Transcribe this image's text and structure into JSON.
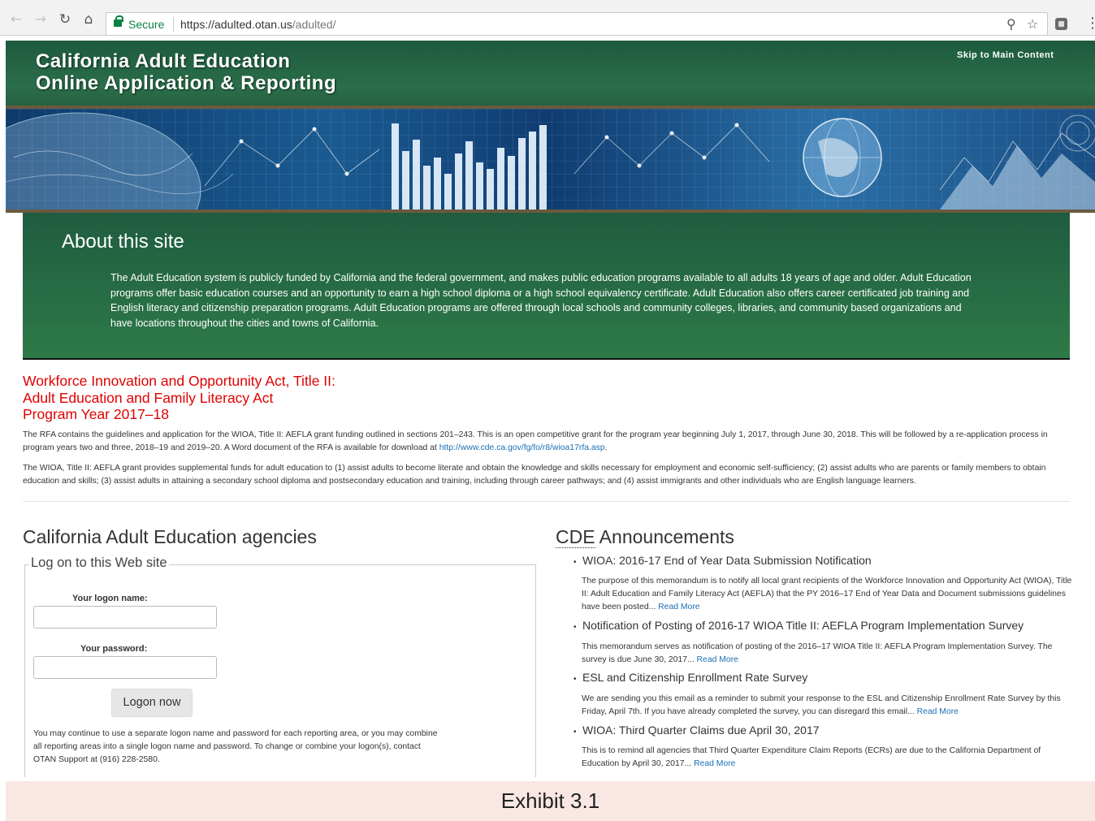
{
  "browser": {
    "secure_label": "Secure",
    "url_host": "https://adulted.otan.us",
    "url_path": "/adulted/",
    "icons": [
      "back-arrow-icon",
      "forward-arrow-icon",
      "reload-icon",
      "home-icon",
      "lock-icon",
      "zoom-icon",
      "star-icon",
      "extension-icon",
      "menu-icon"
    ]
  },
  "header": {
    "title_line1": "California Adult Education",
    "title_line2": "Online Application & Reporting",
    "skip_link": "Skip to Main Content"
  },
  "about": {
    "title": "About this site",
    "text": "The Adult Education system is publicly funded by California and the federal government, and makes public education programs available to all adults 18 years of age and older. Adult Education programs offer basic education courses and an opportunity to earn a high school diploma or a high school equivalency certificate. Adult Education also offers career certificated job training and English literacy and citizenship preparation programs. Adult Education programs are offered through local schools and community colleges, libraries, and community based organizations and have locations throughout the cities and towns of California."
  },
  "wioa": {
    "title_line1": "Workforce Innovation and Opportunity Act, Title II:",
    "title_line2": "Adult Education and Family Literacy Act",
    "title_line3": "Program Year 2017–18",
    "para1": "The RFA contains the guidelines and application for the WIOA, Title II: AEFLA grant funding outlined in sections 201–243. This is an open competitive grant for the program year beginning July 1, 2017, through June 30, 2018. This will be followed by a re-application process in program years two and three, 2018–19 and 2019–20. A Word document of the RFA is available for download at",
    "para1_link": "http://www.cde.ca.gov/fg/fo/r8/wioa17rfa.asp",
    "para1_end": ".",
    "para2": "The WIOA, Title II: AEFLA grant provides supplemental funds for adult education to (1) assist adults to become literate and obtain the knowledge and skills necessary for employment and economic self-sufficiency; (2) assist adults who are parents or family members to obtain education and skills; (3) assist adults in attaining a secondary school diploma and postsecondary education and training, including through career pathways; and (4) assist immigrants and other individuals who are English language learners."
  },
  "agencies": {
    "title": "California Adult Education agencies",
    "legend": "Log on to this Web site",
    "logon_label": "Your logon name:",
    "logon_value": "",
    "password_label": "Your password:",
    "password_value": "",
    "button": "Logon now",
    "note": "You may continue to use a separate logon name and password for each reporting area, or you may combine all reporting areas into a single logon name and password. To change or combine your logon(s), contact OTAN Support at (916) 228-2580."
  },
  "announcements": {
    "title_abbr": "CDE",
    "title_rest": " Announcements",
    "read_more": "Read More",
    "items": [
      {
        "title": "WIOA: 2016-17 End of Year Data Submission Notification",
        "desc": "The purpose of this memorandum is to notify all local grant recipients of the Workforce Innovation and Opportunity Act (WIOA), Title II: Adult Education and Family Literacy Act (AEFLA) that the PY 2016–17 End of Year Data and Document submissions guidelines have been posted..."
      },
      {
        "title": "Notification of Posting of 2016-17 WIOA Title II: AEFLA Program Implementation Survey",
        "desc": "This memorandum serves as notification of posting of the 2016–17 WIOA Title II: AEFLA Program Implementation Survey. The survey is due June 30, 2017..."
      },
      {
        "title": "ESL and Citizenship Enrollment Rate Survey",
        "desc": "We are sending you this email as a reminder to submit your response to the ESL and Citizenship Enrollment Rate Survey by this Friday, April 7th. If you have already completed the survey, you can disregard this email..."
      },
      {
        "title": "WIOA: Third Quarter Claims due April 30, 2017",
        "desc": "This is to remind all agencies that Third Quarter Expenditure Claim Reports (ECRs) are due to the California Department of Education by April 30, 2017..."
      }
    ]
  },
  "caption": "Exhibit 3.1"
}
